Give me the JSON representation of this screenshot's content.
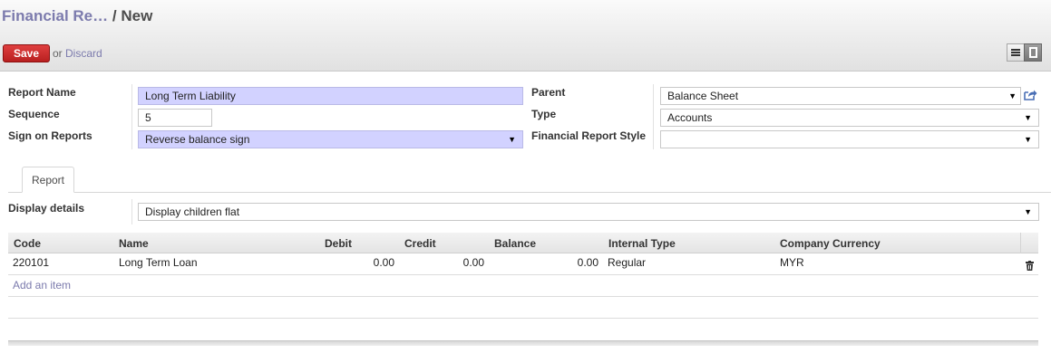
{
  "breadcrumb": {
    "parent": "Financial Re…",
    "separator": "/",
    "current": "New"
  },
  "toolbar": {
    "save_label": "Save",
    "or_label": "or",
    "discard_label": "Discard"
  },
  "form": {
    "report_name": {
      "label": "Report Name",
      "value": "Long Term Liability"
    },
    "sequence": {
      "label": "Sequence",
      "value": "5"
    },
    "sign_on_reports": {
      "label": "Sign on Reports",
      "value": "Reverse balance sign"
    },
    "parent": {
      "label": "Parent",
      "value": "Balance Sheet"
    },
    "type": {
      "label": "Type",
      "value": "Accounts"
    },
    "style": {
      "label": "Financial Report Style",
      "value": ""
    },
    "display_details": {
      "label": "Display details",
      "value": "Display children flat"
    }
  },
  "tabs": [
    {
      "label": "Report",
      "active": true
    }
  ],
  "table": {
    "columns": [
      "Code",
      "Name",
      "Debit",
      "Credit",
      "Balance",
      "Internal Type",
      "Company Currency"
    ],
    "rows": [
      {
        "code": "220101",
        "name": "Long Term Loan",
        "debit": "0.00",
        "credit": "0.00",
        "balance": "0.00",
        "internal_type": "Regular",
        "currency": "MYR"
      }
    ],
    "add_item_label": "Add an item"
  },
  "icons": {
    "external_link": "external-link-icon",
    "trash": "trash-icon",
    "list_view": "list-view-icon",
    "form_view": "form-view-icon"
  },
  "colors": {
    "save_button": "#c9302c",
    "link": "#7c7bad",
    "required_field": "#d2d2ff"
  }
}
